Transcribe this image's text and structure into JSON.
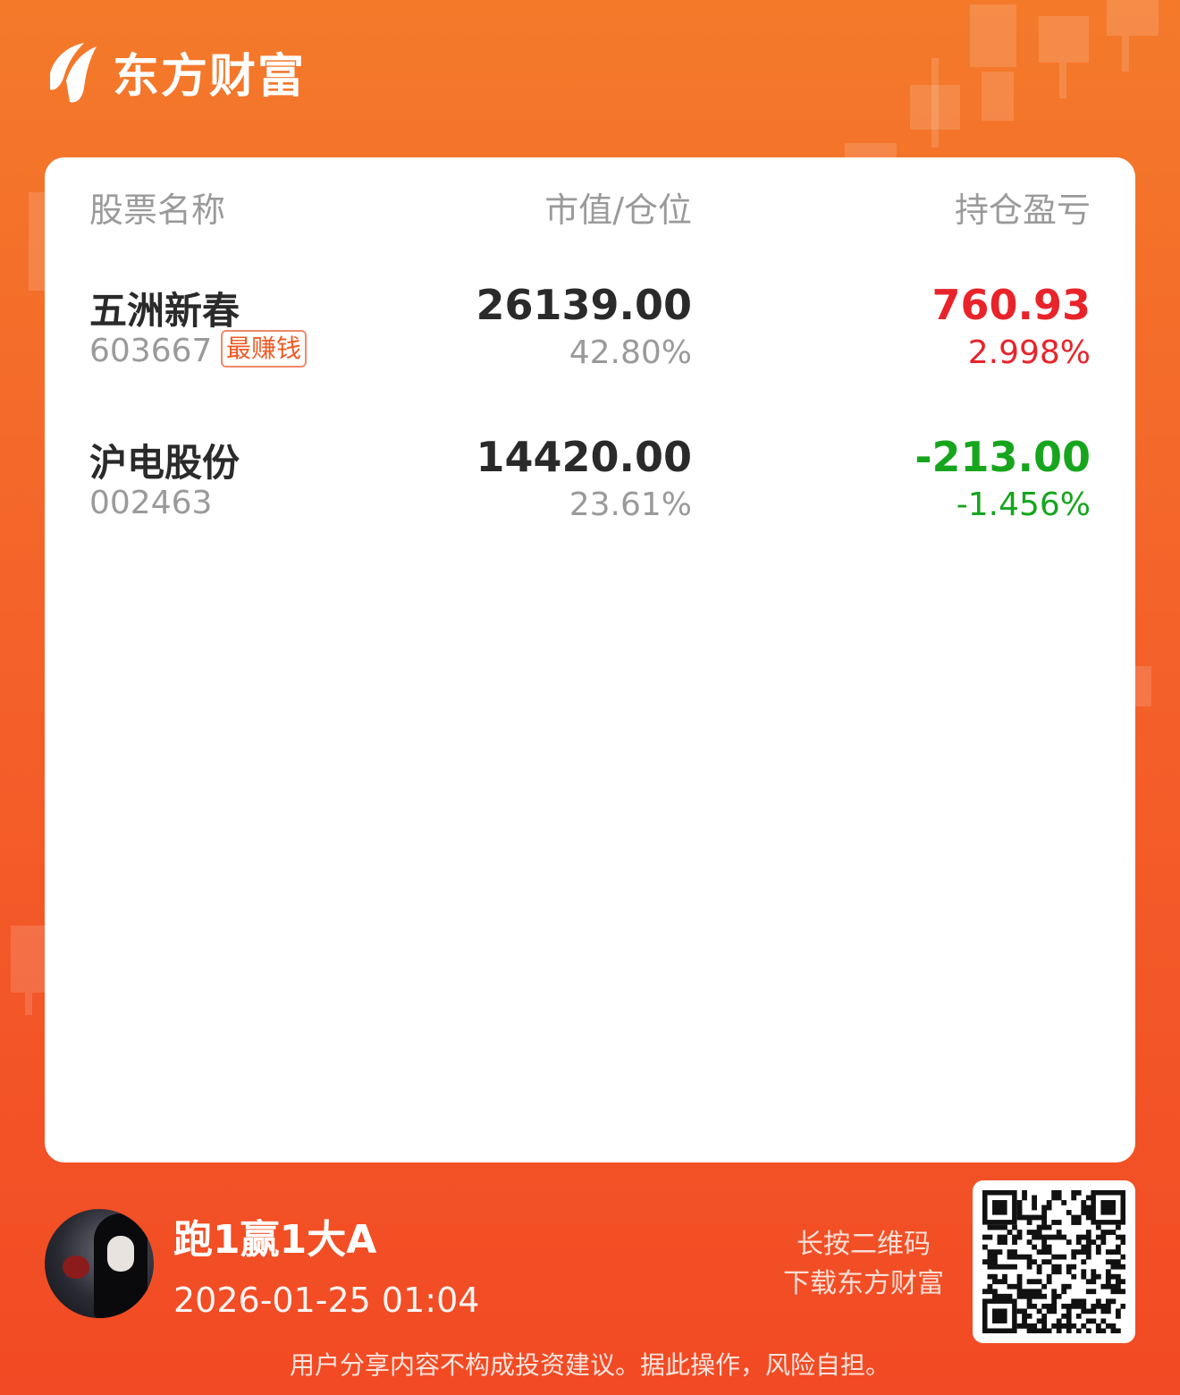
{
  "brand": {
    "name": "东方财富"
  },
  "table": {
    "headers": {
      "name": "股票名称",
      "value": "市值/仓位",
      "pl": "持仓盈亏"
    },
    "rows": [
      {
        "name": "五洲新春",
        "code": "603667",
        "tag": "最赚钱",
        "market_value": "26139.00",
        "position": "42.80%",
        "pl": "760.93",
        "pl_rate": "2.998%",
        "trend": "up"
      },
      {
        "name": "沪电股份",
        "code": "002463",
        "tag": "",
        "market_value": "14420.00",
        "position": "23.61%",
        "pl": "-213.00",
        "pl_rate": "-1.456%",
        "trend": "down"
      }
    ]
  },
  "user": {
    "name": "跑1赢1大A",
    "time": "2026-01-25 01:04"
  },
  "qr": {
    "hint_line1": "长按二维码",
    "hint_line2": "下载东方财富"
  },
  "disclaimer": "用户分享内容不构成投资建议。据此操作，风险自担。",
  "colors": {
    "up": "#e8242a",
    "down": "#17a51d",
    "brand": "#f46a28"
  }
}
